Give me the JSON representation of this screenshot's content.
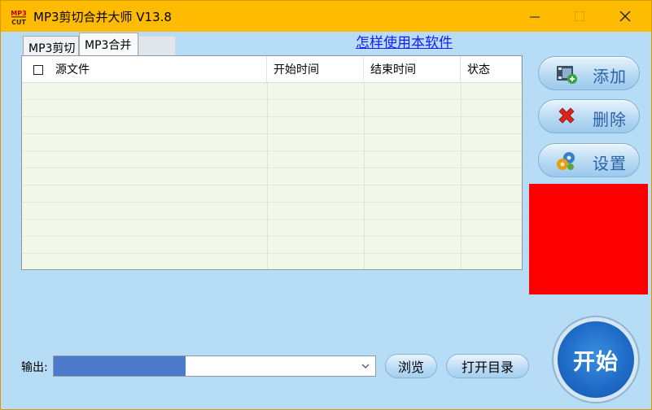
{
  "window": {
    "title": "MP3剪切合并大师 V13.8",
    "logo_top": "MP3",
    "logo_bottom": "CUT",
    "accent_color": "#ffbb00"
  },
  "tabs": [
    {
      "label": "MP3剪切",
      "active": false
    },
    {
      "label": "MP3合并",
      "active": true
    }
  ],
  "help_link": "怎样使用本软件",
  "table": {
    "columns": [
      "源文件",
      "开始时间",
      "结束时间",
      "状态"
    ],
    "rows": []
  },
  "side_buttons": {
    "add": "添加",
    "delete": "删除",
    "settings": "设置"
  },
  "output": {
    "label": "输出:",
    "value": "",
    "progress_fraction": 0.41
  },
  "buttons": {
    "browse": "浏览",
    "open_dir": "打开目录",
    "start": "开始"
  }
}
